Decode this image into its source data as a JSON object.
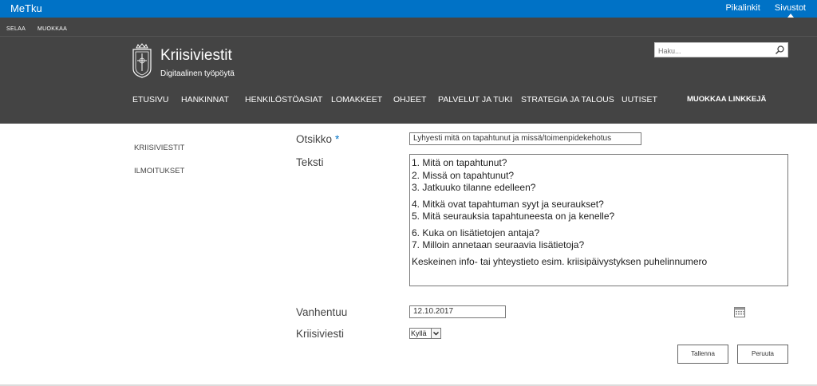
{
  "suitebar": {
    "brand": "MeTku",
    "links": [
      "Pikalinkit",
      "Sivustot"
    ]
  },
  "ribbon": {
    "tabs": [
      "SELAA",
      "MUOKKAA"
    ]
  },
  "site": {
    "title": "Kriisiviestit",
    "subtitle": "Digitaalinen työpöytä"
  },
  "search": {
    "placeholder": "Haku..."
  },
  "topnav": {
    "items": [
      "ETUSIVU",
      "HANKINNAT",
      "HENKILÖSTÖASIAT",
      "LOMAKKEET",
      "OHJEET",
      "PALVELUT JA TUKI",
      "STRATEGIA JA TALOUS",
      "UUTISET"
    ],
    "edit_links": "MUOKKAA LINKKEJÄ"
  },
  "leftnav": {
    "items": [
      "KRIISIVIESTIT",
      "ILMOITUKSET"
    ]
  },
  "form": {
    "title_label": "Otsikko",
    "required_mark": "*",
    "title_value": "Lyhyesti mitä on tapahtunut ja missä/toimenpidekehotus",
    "text_label": "Teksti",
    "text_lines": [
      "1. Mitä on tapahtunut?",
      "2. Missä on tapahtunut?",
      "3. Jatkuuko tilanne edelleen?",
      "4. Mitkä ovat tapahtuman syyt ja seuraukset?",
      "5. Mitä seurauksia tapahtuneesta on ja kenelle?",
      "6. Kuka on lisätietojen antaja?",
      "7. Milloin annetaan seuraavia lisätietoja?",
      "Keskeinen info- tai yhteystieto esim. kriisipäivystyksen puhelinnumero"
    ],
    "expires_label": "Vanhentuu",
    "expires_value": "12.10.2017",
    "crisis_label": "Kriisiviesti",
    "crisis_value": "Kyllä",
    "save_label": "Tallenna",
    "cancel_label": "Peruuta"
  },
  "icons": {
    "search": "search-icon",
    "calendar": "calendar-icon",
    "logo": "coat-of-arms-logo"
  },
  "colors": {
    "suitebar": "#0072c6",
    "header": "#444444"
  }
}
